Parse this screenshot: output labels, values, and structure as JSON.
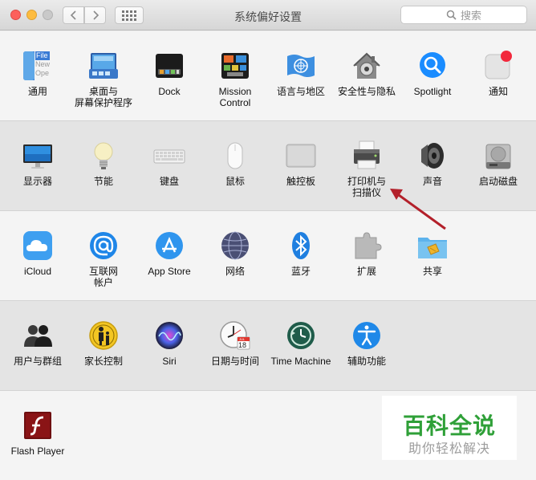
{
  "window": {
    "title": "系统偏好设置",
    "search_placeholder": "搜索",
    "nav_back_icon": "chevron-left-icon",
    "nav_forward_icon": "chevron-right-icon"
  },
  "rows": [
    {
      "items": [
        {
          "id": "general",
          "label": "通用",
          "icon": "general-file-icon"
        },
        {
          "id": "desktop",
          "label": "桌面与\n屏幕保护程序",
          "icon": "desktop-screensaver-icon"
        },
        {
          "id": "dock",
          "label": "Dock",
          "icon": "dock-icon"
        },
        {
          "id": "mission",
          "label": "Mission\nControl",
          "icon": "mission-control-icon"
        },
        {
          "id": "language",
          "label": "语言与地区",
          "icon": "un-flag-icon"
        },
        {
          "id": "security",
          "label": "安全性与隐私",
          "icon": "house-lock-icon"
        },
        {
          "id": "spotlight",
          "label": "Spotlight",
          "icon": "magnifier-icon"
        },
        {
          "id": "notifications",
          "label": "通知",
          "icon": "notification-badge-icon"
        }
      ]
    },
    {
      "items": [
        {
          "id": "displays",
          "label": "显示器",
          "icon": "monitor-icon"
        },
        {
          "id": "energy",
          "label": "节能",
          "icon": "lightbulb-icon"
        },
        {
          "id": "keyboard",
          "label": "键盘",
          "icon": "keyboard-icon"
        },
        {
          "id": "mouse",
          "label": "鼠标",
          "icon": "mouse-icon"
        },
        {
          "id": "trackpad",
          "label": "触控板",
          "icon": "trackpad-icon"
        },
        {
          "id": "printers",
          "label": "打印机与\n扫描仪",
          "icon": "printer-icon"
        },
        {
          "id": "sound",
          "label": "声音",
          "icon": "speaker-icon"
        },
        {
          "id": "startup",
          "label": "启动磁盘",
          "icon": "hard-disk-icon"
        }
      ]
    },
    {
      "items": [
        {
          "id": "icloud",
          "label": "iCloud",
          "icon": "cloud-icon"
        },
        {
          "id": "internet",
          "label": "互联网\n帐户",
          "icon": "at-sign-icon"
        },
        {
          "id": "appstore",
          "label": "App Store",
          "icon": "app-store-icon"
        },
        {
          "id": "network",
          "label": "网络",
          "icon": "globe-icon"
        },
        {
          "id": "bluetooth",
          "label": "蓝牙",
          "icon": "bluetooth-icon"
        },
        {
          "id": "extensions",
          "label": "扩展",
          "icon": "puzzle-icon"
        },
        {
          "id": "sharing",
          "label": "共享",
          "icon": "sharing-folder-icon"
        }
      ]
    },
    {
      "items": [
        {
          "id": "users",
          "label": "用户与群组",
          "icon": "users-icon"
        },
        {
          "id": "parental",
          "label": "家长控制",
          "icon": "parental-icon"
        },
        {
          "id": "siri",
          "label": "Siri",
          "icon": "siri-icon"
        },
        {
          "id": "datetime",
          "label": "日期与时间",
          "icon": "clock-calendar-icon"
        },
        {
          "id": "timemachine",
          "label": "Time Machine",
          "icon": "time-machine-icon"
        },
        {
          "id": "accessibility",
          "label": "辅助功能",
          "icon": "accessibility-icon"
        }
      ]
    },
    {
      "items": [
        {
          "id": "flash",
          "label": "Flash Player",
          "icon": "flash-player-icon"
        }
      ]
    }
  ],
  "calendar_icon": {
    "month": "JUL",
    "day": "18"
  },
  "general_icon": {
    "lines": [
      "File",
      "New",
      "Ope"
    ]
  },
  "watermark": {
    "main": "百科全说",
    "sub": "助你轻松解决"
  },
  "colors": {
    "annotation_arrow": "#b3202a",
    "watermark_green": "#2fa038",
    "accent_blue": "#1a8cff"
  }
}
